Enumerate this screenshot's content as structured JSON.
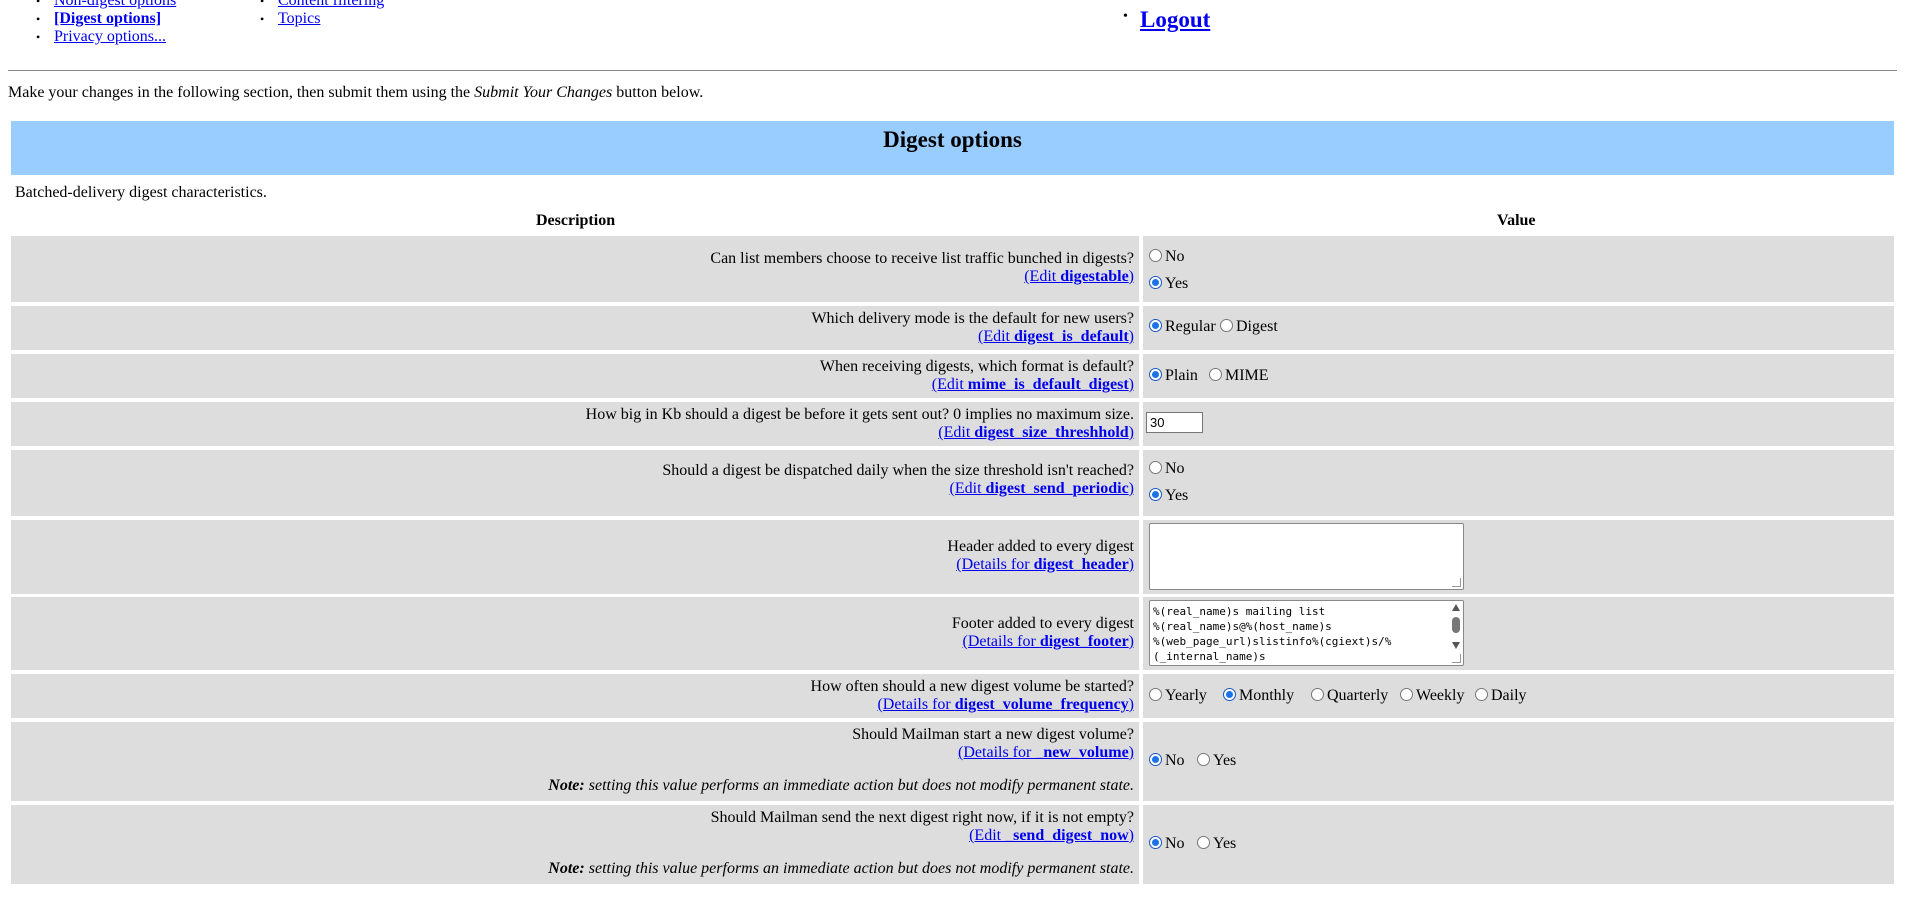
{
  "nav": {
    "col1": [
      "Non-digest options",
      "[Digest options]",
      "Privacy options..."
    ],
    "col2": [
      "Content filtering",
      "Topics"
    ],
    "logout": "Logout"
  },
  "intro": {
    "before": "Make your changes in the following section, then submit them using the ",
    "button_name": "Submit Your Changes",
    "after": " button below."
  },
  "section": {
    "title": "Digest options",
    "subtitle": "Batched-delivery digest characteristics.",
    "col_description": "Description",
    "col_value": "Value"
  },
  "rows": {
    "digestable": {
      "question": "Can list members choose to receive list traffic bunched in digests?",
      "link_prefix": "(Edit ",
      "link_var": "digestable",
      "link_suffix": ")",
      "options": [
        "No",
        "Yes"
      ],
      "selected": "Yes"
    },
    "digest_is_default": {
      "question": "Which delivery mode is the default for new users?",
      "link_prefix": "(Edit ",
      "link_var": "digest_is_default",
      "link_suffix": ")",
      "options": [
        "Regular",
        "Digest"
      ],
      "selected": "Regular"
    },
    "mime_is_default_digest": {
      "question": "When receiving digests, which format is default?",
      "link_prefix": "(Edit ",
      "link_var": "mime_is_default_digest",
      "link_suffix": ")",
      "options": [
        "Plain",
        "MIME"
      ],
      "selected": "Plain"
    },
    "digest_size_threshhold": {
      "question": "How big in Kb should a digest be before it gets sent out? 0 implies no maximum size.",
      "link_prefix": "(Edit ",
      "link_var": "digest_size_threshhold",
      "link_suffix": ")",
      "value": "30"
    },
    "digest_send_periodic": {
      "question": "Should a digest be dispatched daily when the size threshold isn't reached?",
      "link_prefix": "(Edit ",
      "link_var": "digest_send_periodic",
      "link_suffix": ")",
      "options": [
        "No",
        "Yes"
      ],
      "selected": "Yes"
    },
    "digest_header": {
      "question": "Header added to every digest",
      "link_prefix": "(Details for ",
      "link_var": "digest_header",
      "link_suffix": ")",
      "value": ""
    },
    "digest_footer": {
      "question": "Footer added to every digest",
      "link_prefix": "(Details for ",
      "link_var": "digest_footer",
      "link_suffix": ")",
      "lines": [
        "%(real_name)s mailing list",
        "%(real_name)s@%(host_name)s",
        "%(web_page_url)slistinfo%(cgiext)s/%",
        "(_internal_name)s"
      ]
    },
    "digest_volume_frequency": {
      "question": "How often should a new digest volume be started?",
      "link_prefix": "(Details for ",
      "link_var": "digest_volume_frequency",
      "link_suffix": ")",
      "options": [
        "Yearly",
        "Monthly",
        "Quarterly",
        "Weekly",
        "Daily"
      ],
      "selected": "Monthly"
    },
    "new_volume": {
      "question": "Should Mailman start a new digest volume?",
      "link_prefix": "(Details for ",
      "link_var": "_new_volume",
      "link_suffix": ")",
      "note_label": "Note:",
      "note_text": " setting this value performs an immediate action but does not modify permanent state.",
      "options": [
        "No",
        "Yes"
      ],
      "selected": "No"
    },
    "send_digest_now": {
      "question": "Should Mailman send the next digest right now, if it is not empty?",
      "link_prefix": "(Edit ",
      "link_var": "_send_digest_now",
      "link_suffix": ")",
      "note_label": "Note:",
      "note_text": " setting this value performs an immediate action but does not modify permanent state.",
      "options": [
        "No",
        "Yes"
      ],
      "selected": "No"
    }
  },
  "colors": {
    "banner": "#99ccff",
    "row_bg": "#dddddd",
    "link": "#0000ee"
  }
}
